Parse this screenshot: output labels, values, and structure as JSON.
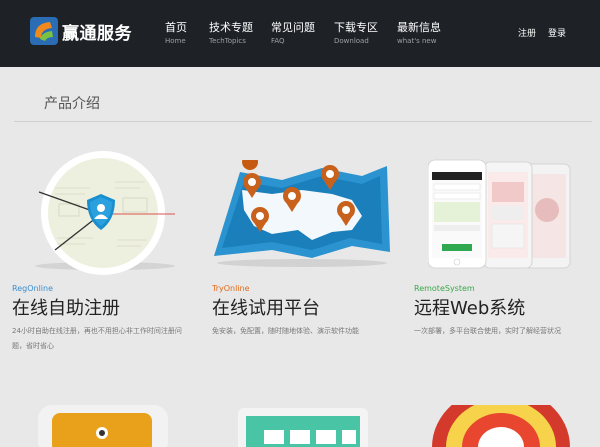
{
  "header": {
    "brand": "赢通服务",
    "nav": [
      {
        "label": "首页",
        "sub": "Home"
      },
      {
        "label": "技术专题",
        "sub": "TechTopics"
      },
      {
        "label": "常见问题",
        "sub": "FAQ"
      },
      {
        "label": "下载专区",
        "sub": "Download"
      },
      {
        "label": "最新信息",
        "sub": "what's new"
      }
    ],
    "register": "注册",
    "login": "登录"
  },
  "section": {
    "title": "产品介绍"
  },
  "products": [
    {
      "sub": "RegOnline",
      "name": "在线自助注册",
      "desc": "24小时自助在线注册，再也不用担心非工作时间注册问题，省时省心",
      "sub_color": "#3a8fd1"
    },
    {
      "sub": "TryOnline",
      "name": "在线试用平台",
      "desc": "免安装，免配置，随时随地体验、演示软件功能",
      "sub_color": "#e06a1e"
    },
    {
      "sub": "RemoteSystem",
      "name": "远程Web系统",
      "desc": "一次部署，多平台联合使用，实时了解经营状况",
      "sub_color": "#3aa84a"
    }
  ]
}
